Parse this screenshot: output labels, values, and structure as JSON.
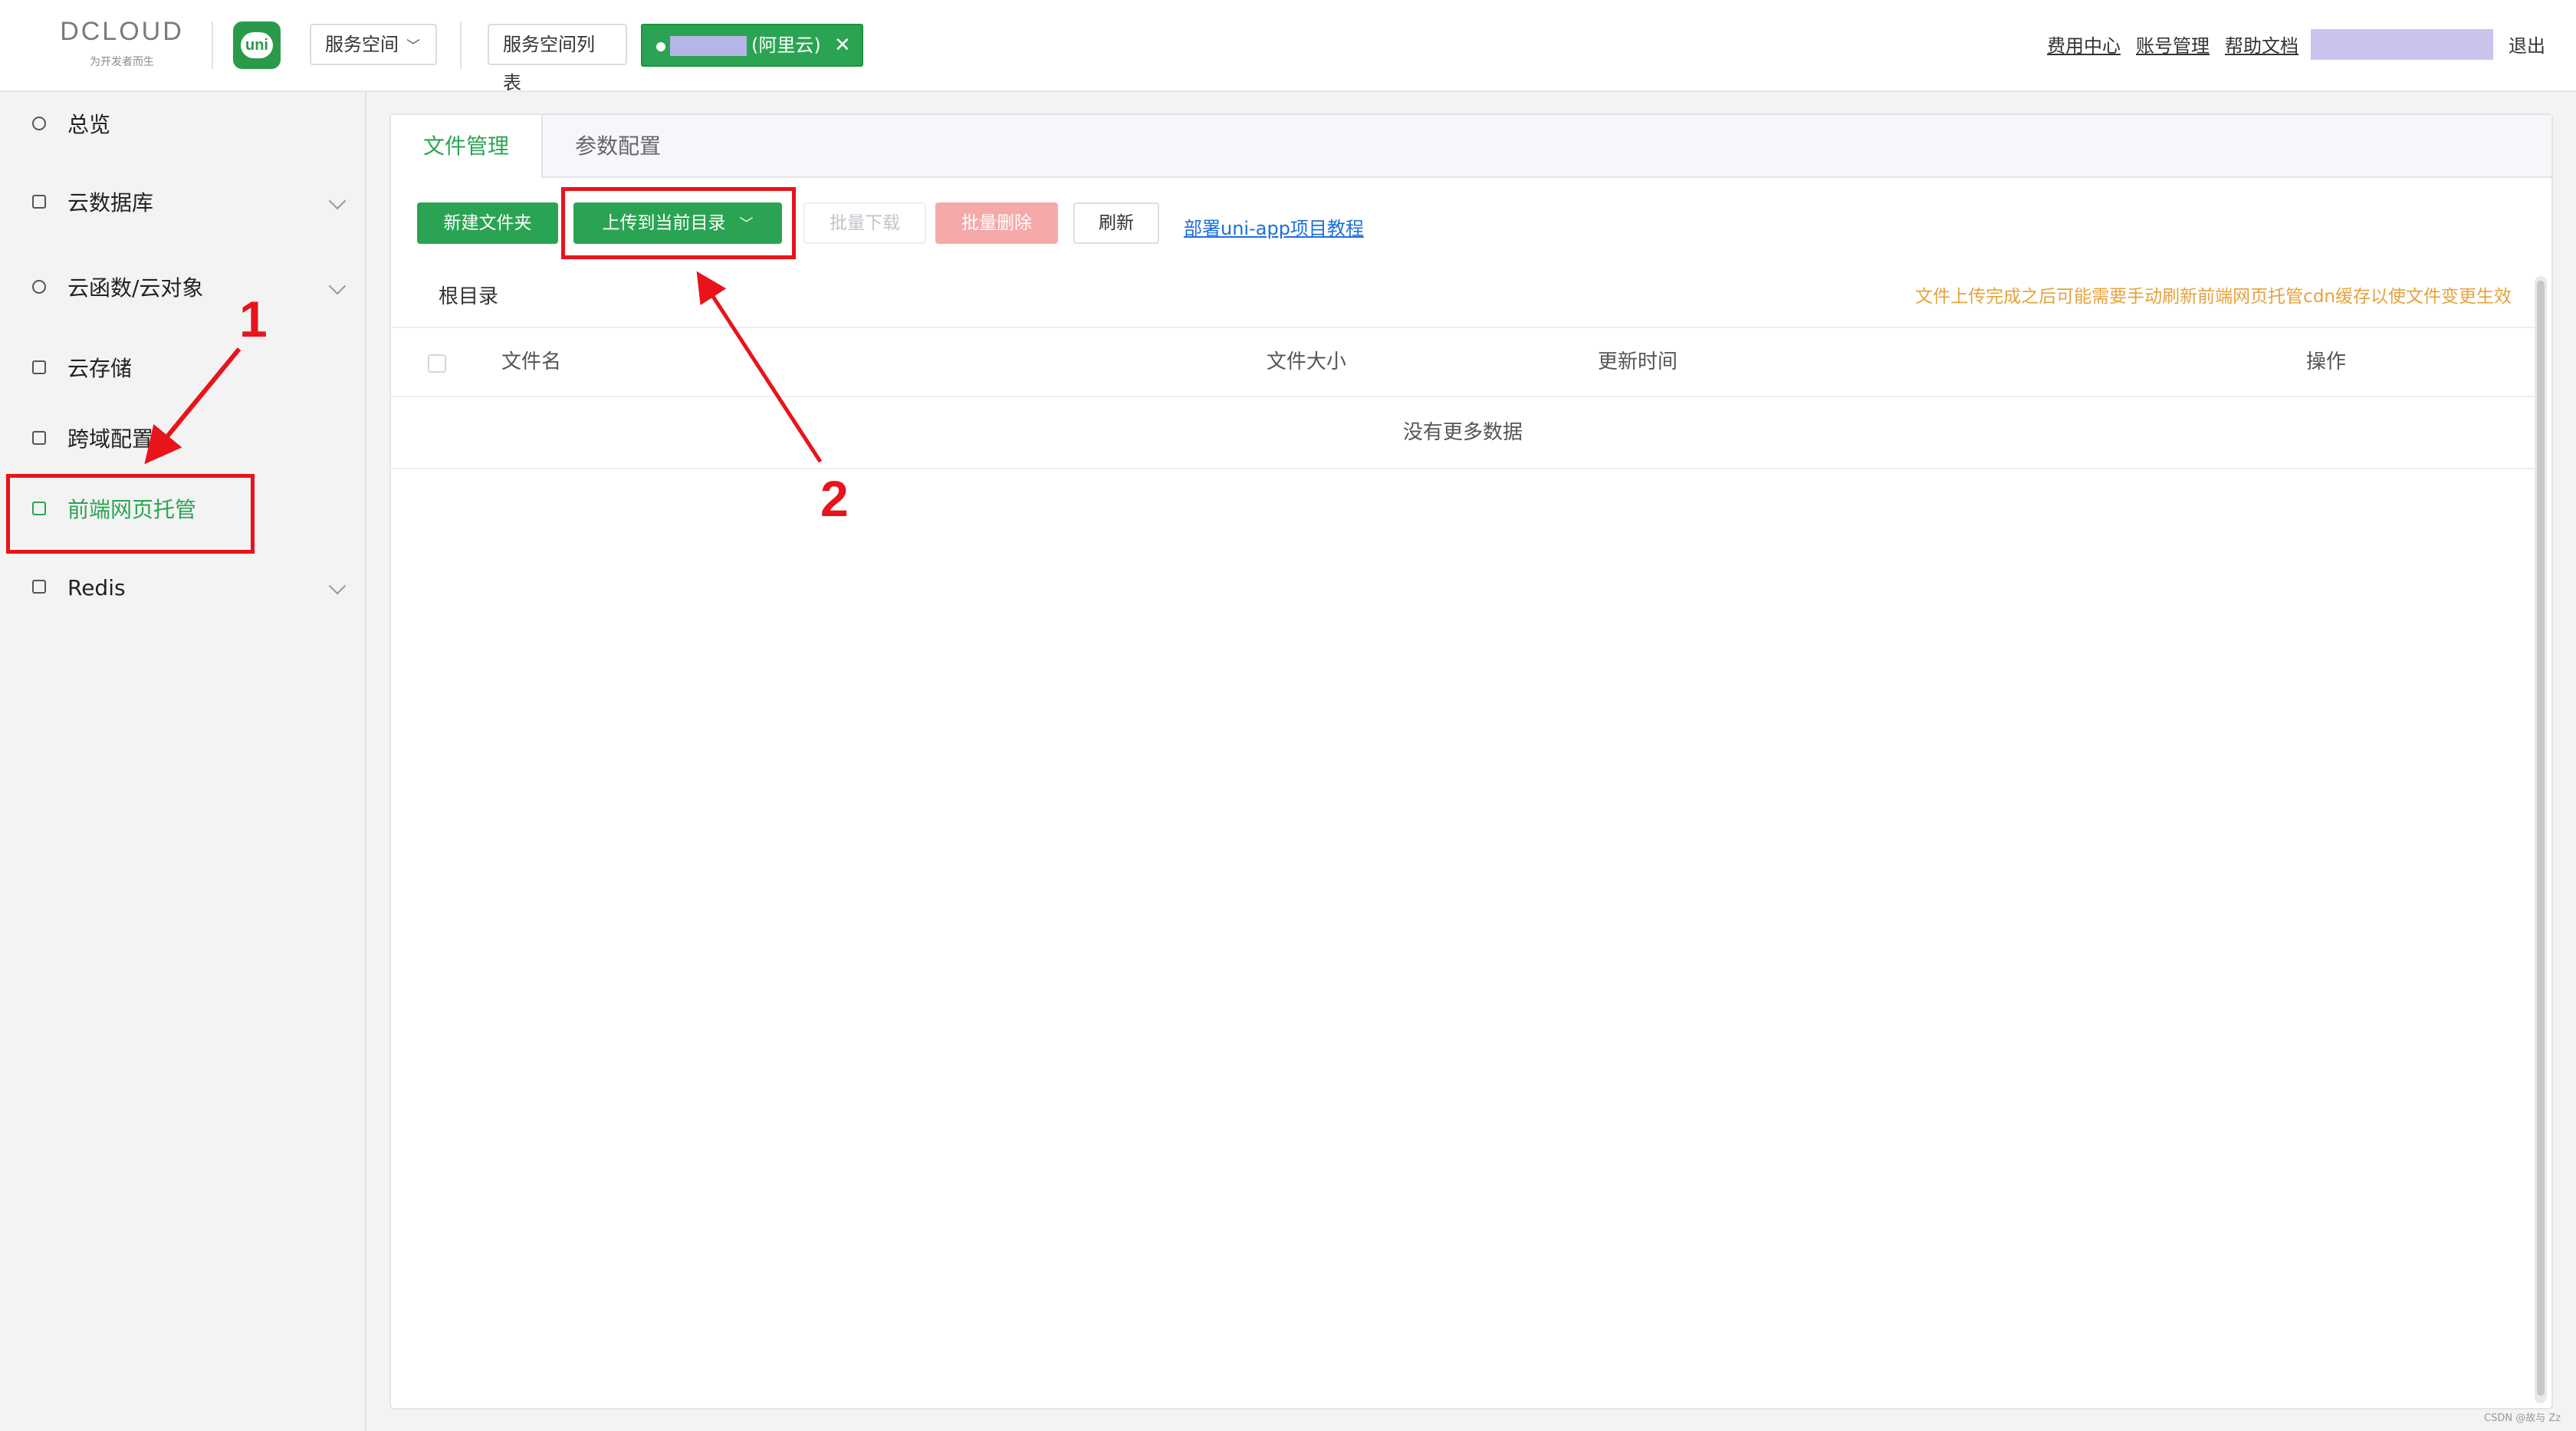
{
  "header": {
    "logo_text": "DCLOUD",
    "logo_tagline": "为开发者而生",
    "uni_logo_text": "uni",
    "space_dropdown_label": "服务空间",
    "space_list_button": "服务空间列表",
    "env_tag_label": "(阿里云)",
    "env_tag_close": "✕",
    "links": {
      "billing": "费用中心",
      "account": "账号管理",
      "help": "帮助文档"
    },
    "logout": "退出"
  },
  "sidebar": {
    "items": [
      {
        "label": "总览",
        "icon": "overview-icon",
        "expandable": false
      },
      {
        "label": "云数据库",
        "icon": "database-icon",
        "expandable": true
      },
      {
        "label": "云函数/云对象",
        "icon": "cloud-function-icon",
        "expandable": true
      },
      {
        "label": "云存储",
        "icon": "storage-icon",
        "expandable": false
      },
      {
        "label": "跨域配置",
        "icon": "cors-icon",
        "expandable": false
      },
      {
        "label": "前端网页托管",
        "icon": "web-hosting-icon",
        "expandable": false,
        "active": true
      },
      {
        "label": "Redis",
        "icon": "redis-icon",
        "expandable": true
      }
    ]
  },
  "main": {
    "tabs": [
      {
        "label": "文件管理",
        "active": true
      },
      {
        "label": "参数配置",
        "active": false
      }
    ],
    "toolbar": {
      "new_folder": "新建文件夹",
      "upload": "上传到当前目录",
      "batch_download": "批量下载",
      "batch_delete": "批量删除",
      "refresh": "刷新",
      "doc_link": "部署uni-app项目教程"
    },
    "breadcrumb": "根目录",
    "notice": "文件上传完成之后可能需要手动刷新前端网页托管cdn缓存以使文件变更生效",
    "table": {
      "columns": [
        "文件名",
        "文件大小",
        "更新时间",
        "操作"
      ],
      "empty_text": "没有更多数据"
    }
  },
  "annotations": {
    "one": "1",
    "two": "2",
    "color": "#e8131b"
  },
  "colors": {
    "accent": "#2aa452",
    "danger_light": "#f5a9a9",
    "warning_text": "#e6a23c",
    "link": "#1e6fd9"
  },
  "watermark": "CSDN @故与 Zz"
}
